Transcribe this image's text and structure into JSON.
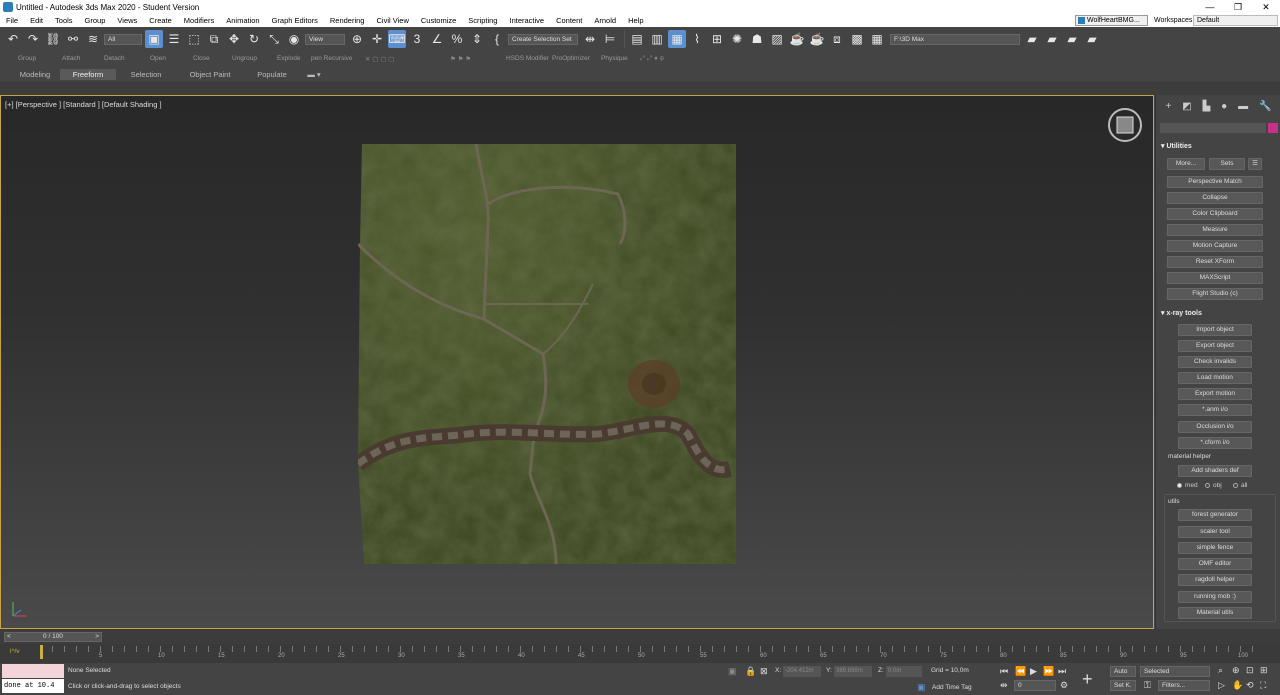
{
  "window": {
    "title": "Untitled - Autodesk 3ds Max 2020 - Student Version",
    "minimize": "—",
    "maximize": "❐",
    "close": "✕"
  },
  "menu": {
    "items": [
      "File",
      "Edit",
      "Tools",
      "Group",
      "Views",
      "Create",
      "Modifiers",
      "Animation",
      "Graph Editors",
      "Rendering",
      "Civil View",
      "Customize",
      "Scripting",
      "Interactive",
      "Content",
      "Arnold",
      "Help"
    ],
    "user": "WolfHeartBMG...",
    "workspaces_label": "Workspaces:",
    "workspace": "Default"
  },
  "toolbar": {
    "selection_filter": "All",
    "ref_coord": "View",
    "named_selection": "Create Selection Set",
    "render_path": "F:\\3D Max"
  },
  "toolbar2": {
    "labels": [
      "Group",
      "Attach",
      "Detach",
      "Open",
      "Close",
      "Ungroup",
      "Explode",
      "pen Recursive",
      "HSDS Modifier",
      "ProOptimizer",
      "Physique"
    ]
  },
  "ribbon": {
    "tabs": [
      "Modeling",
      "Freeform",
      "Selection",
      "Object Paint",
      "Populate"
    ],
    "active": "Freeform"
  },
  "viewport": {
    "label": "[+] [Perspective ] [Standard ] [Default Shading ]"
  },
  "command_panel": {
    "utilities": {
      "title": "Utilities",
      "more": "More...",
      "sets": "Sets",
      "buttons": [
        "Perspective Match",
        "Collapse",
        "Color Clipboard",
        "Measure",
        "Motion Capture",
        "Reset XForm",
        "MAXScript",
        "Flight Studio (c)"
      ]
    },
    "xray": {
      "title": "x-ray tools",
      "buttons": [
        "Import object",
        "Export object",
        "Check invalids",
        "Load motion",
        "Export motion",
        "*.anm i/o",
        "Occlusion i/o",
        "*.cform i/o"
      ]
    },
    "material_helper": {
      "title": "material helper",
      "button": "Add shaders def",
      "options": [
        "med",
        "obj",
        "all"
      ],
      "selected": "med"
    },
    "utils": {
      "title": "utils",
      "buttons": [
        "forest generator",
        "scaler tool",
        "simple fence",
        "OMF editor",
        "ragdoll helper",
        "running mob :)",
        "Material utils"
      ]
    }
  },
  "timeline": {
    "frame_display": "0 / 100",
    "prev": "<",
    "next": ">",
    "track_label": "l^/v",
    "ticks": [
      "5",
      "10",
      "15",
      "20",
      "25",
      "30",
      "35",
      "40",
      "45",
      "50",
      "55",
      "60",
      "65",
      "70",
      "75",
      "80",
      "85",
      "90",
      "95",
      "100"
    ]
  },
  "status": {
    "listener_text": "done at 10.4",
    "selection": "None Selected",
    "prompt": "Click or click-and-drag to select objects",
    "x_label": "X:",
    "x_value": "-204,412m",
    "y_label": "Y:",
    "y_value": "389,898m",
    "z_label": "Z:",
    "z_value": "0,0m",
    "grid": "Grid = 10,0m",
    "add_time_tag": "Add Time Tag",
    "auto": "Auto",
    "set_key": "Set K.",
    "key_mode": "Selected",
    "filters": "Filters...",
    "frame": "0"
  }
}
